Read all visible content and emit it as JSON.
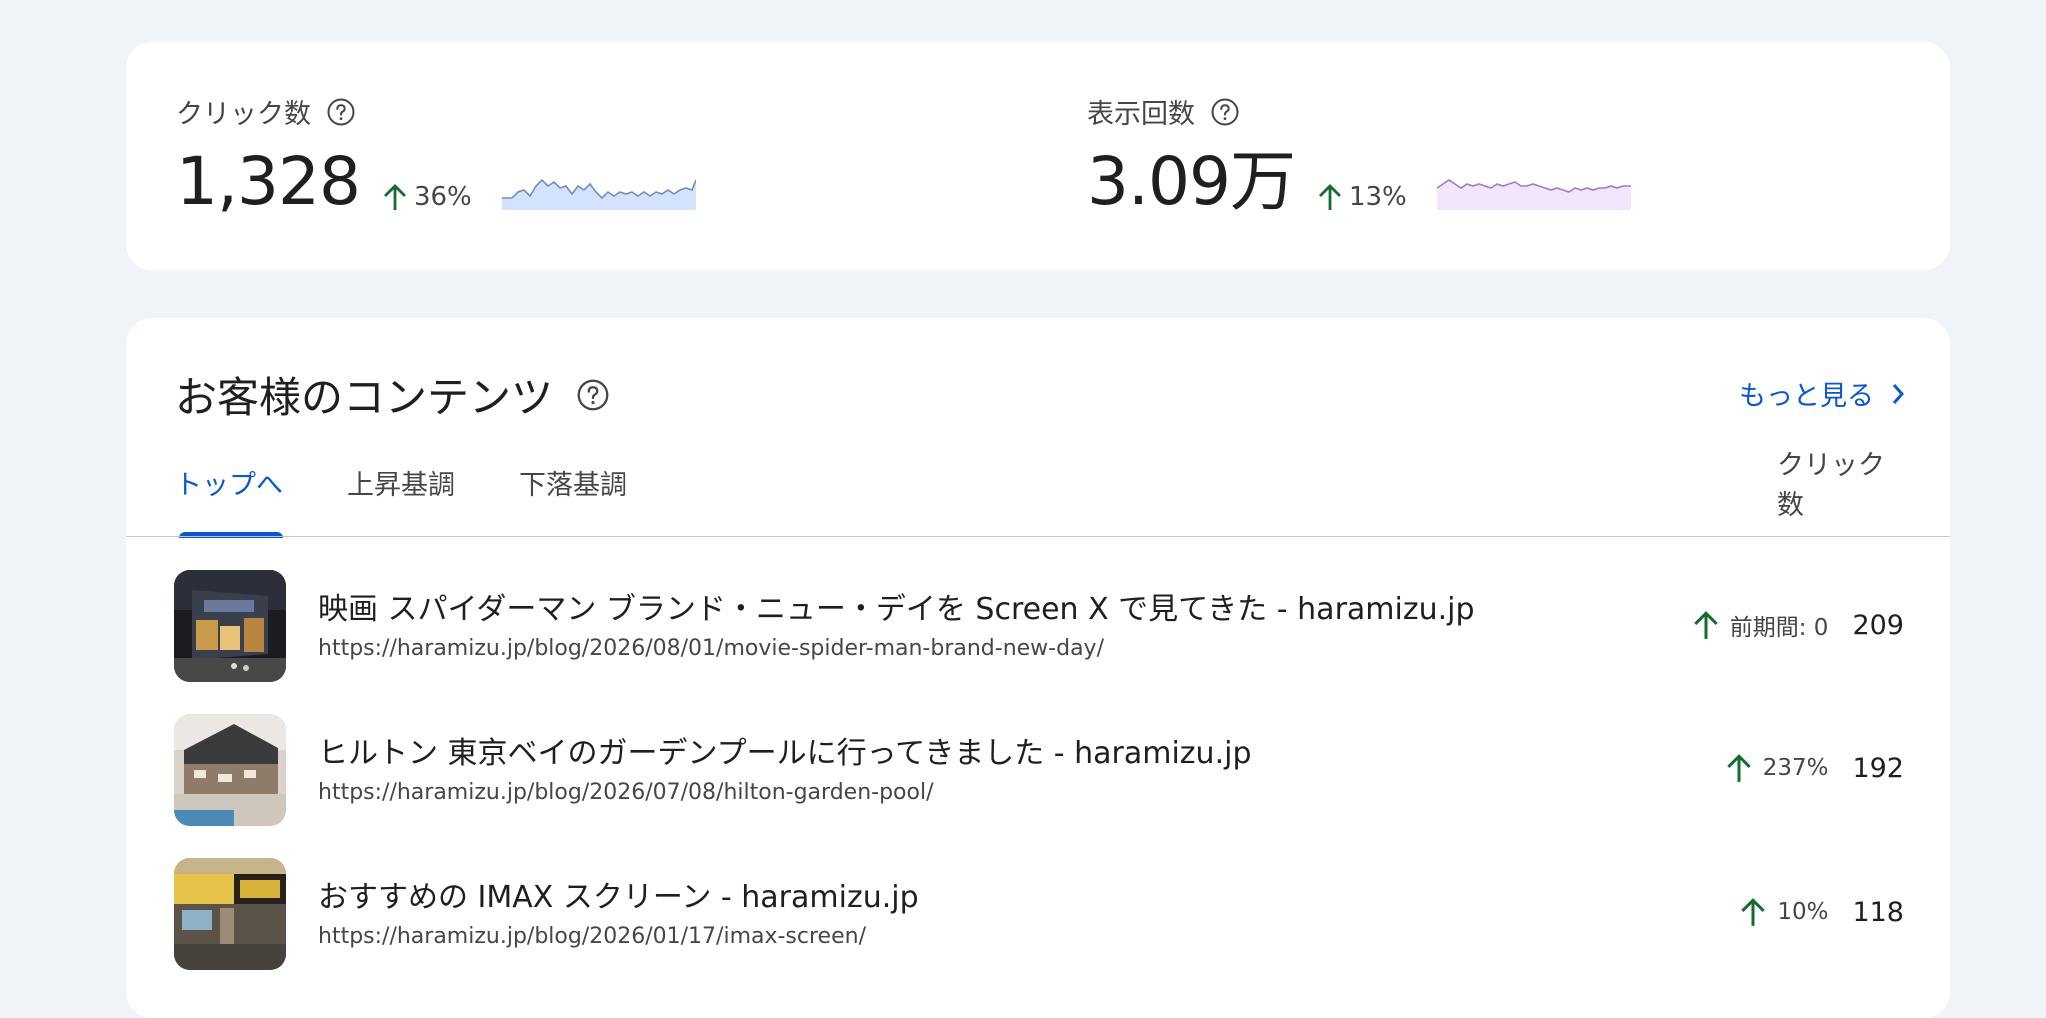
{
  "metrics": {
    "clicks": {
      "label": "クリック数",
      "value": "1,328",
      "change": "36%",
      "sparkline_color": "#8ab4f8",
      "sparkline_fill": "#d3e3fd"
    },
    "impressions": {
      "label": "表示回数",
      "value": "3.09万",
      "change": "13%",
      "sparkline_color": "#a07cc5",
      "sparkline_fill": "#f3e5fc"
    }
  },
  "content": {
    "title": "お客様のコンテンツ",
    "see_more": "もっと見る",
    "tabs": [
      {
        "label": "トップへ",
        "active": true
      },
      {
        "label": "上昇基調",
        "active": false
      },
      {
        "label": "下落基調",
        "active": false
      }
    ],
    "column_header": "クリック数",
    "rows": [
      {
        "title": "映画 スパイダーマン ブランド・ニュー・デイを Screen X で見てきた - haramizu.jp",
        "url": "https://haramizu.jp/blog/2026/08/01/movie-spider-man-brand-new-day/",
        "change": "前期間: 0",
        "clicks": "209"
      },
      {
        "title": "ヒルトン 東京ベイのガーデンプールに行ってきました - haramizu.jp",
        "url": "https://haramizu.jp/blog/2026/07/08/hilton-garden-pool/",
        "change": "237%",
        "clicks": "192"
      },
      {
        "title": "おすすめの IMAX スクリーン - haramizu.jp",
        "url": "https://haramizu.jp/blog/2026/01/17/imax-screen/",
        "change": "10%",
        "clicks": "118"
      }
    ]
  },
  "icons": {
    "help": "help-circle-icon",
    "arrow_up": "arrow-up-icon",
    "chevron": "chevron-right-icon"
  },
  "colors": {
    "accent": "#0b57d0",
    "positive": "#146c2e",
    "background": "#f0f4f9"
  }
}
